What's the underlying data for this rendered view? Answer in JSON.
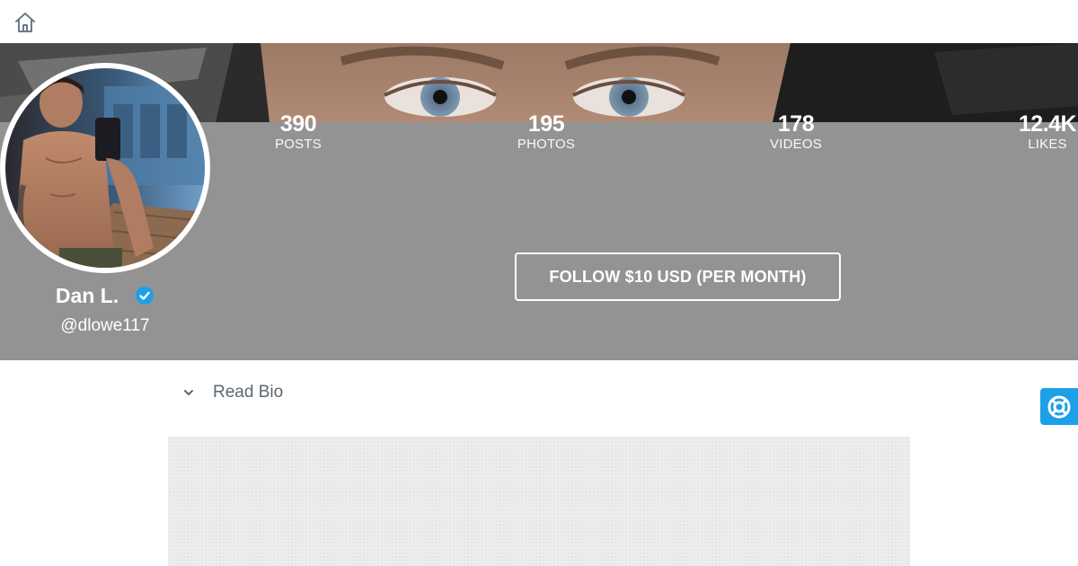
{
  "colors": {
    "header_bg": "#939393",
    "accent": "#1ea0e8",
    "text_white": "#ffffff",
    "bio_text": "#5b6670"
  },
  "topbar": {
    "home_icon": "home-icon"
  },
  "stats": [
    {
      "value": "390",
      "label": "POSTS"
    },
    {
      "value": "195",
      "label": "PHOTOS"
    },
    {
      "value": "178",
      "label": "VIDEOS"
    },
    {
      "value": "12.4K",
      "label": "LIKES"
    }
  ],
  "profile": {
    "name": "Dan L.",
    "handle": "@dlowe117",
    "verified_icon": "verified-badge-icon"
  },
  "follow": {
    "label": "FOLLOW $10 USD (PER MONTH)"
  },
  "bio": {
    "toggle_label": "Read Bio",
    "chevron_icon": "chevron-down-icon"
  },
  "help": {
    "icon": "lifebuoy-icon"
  }
}
